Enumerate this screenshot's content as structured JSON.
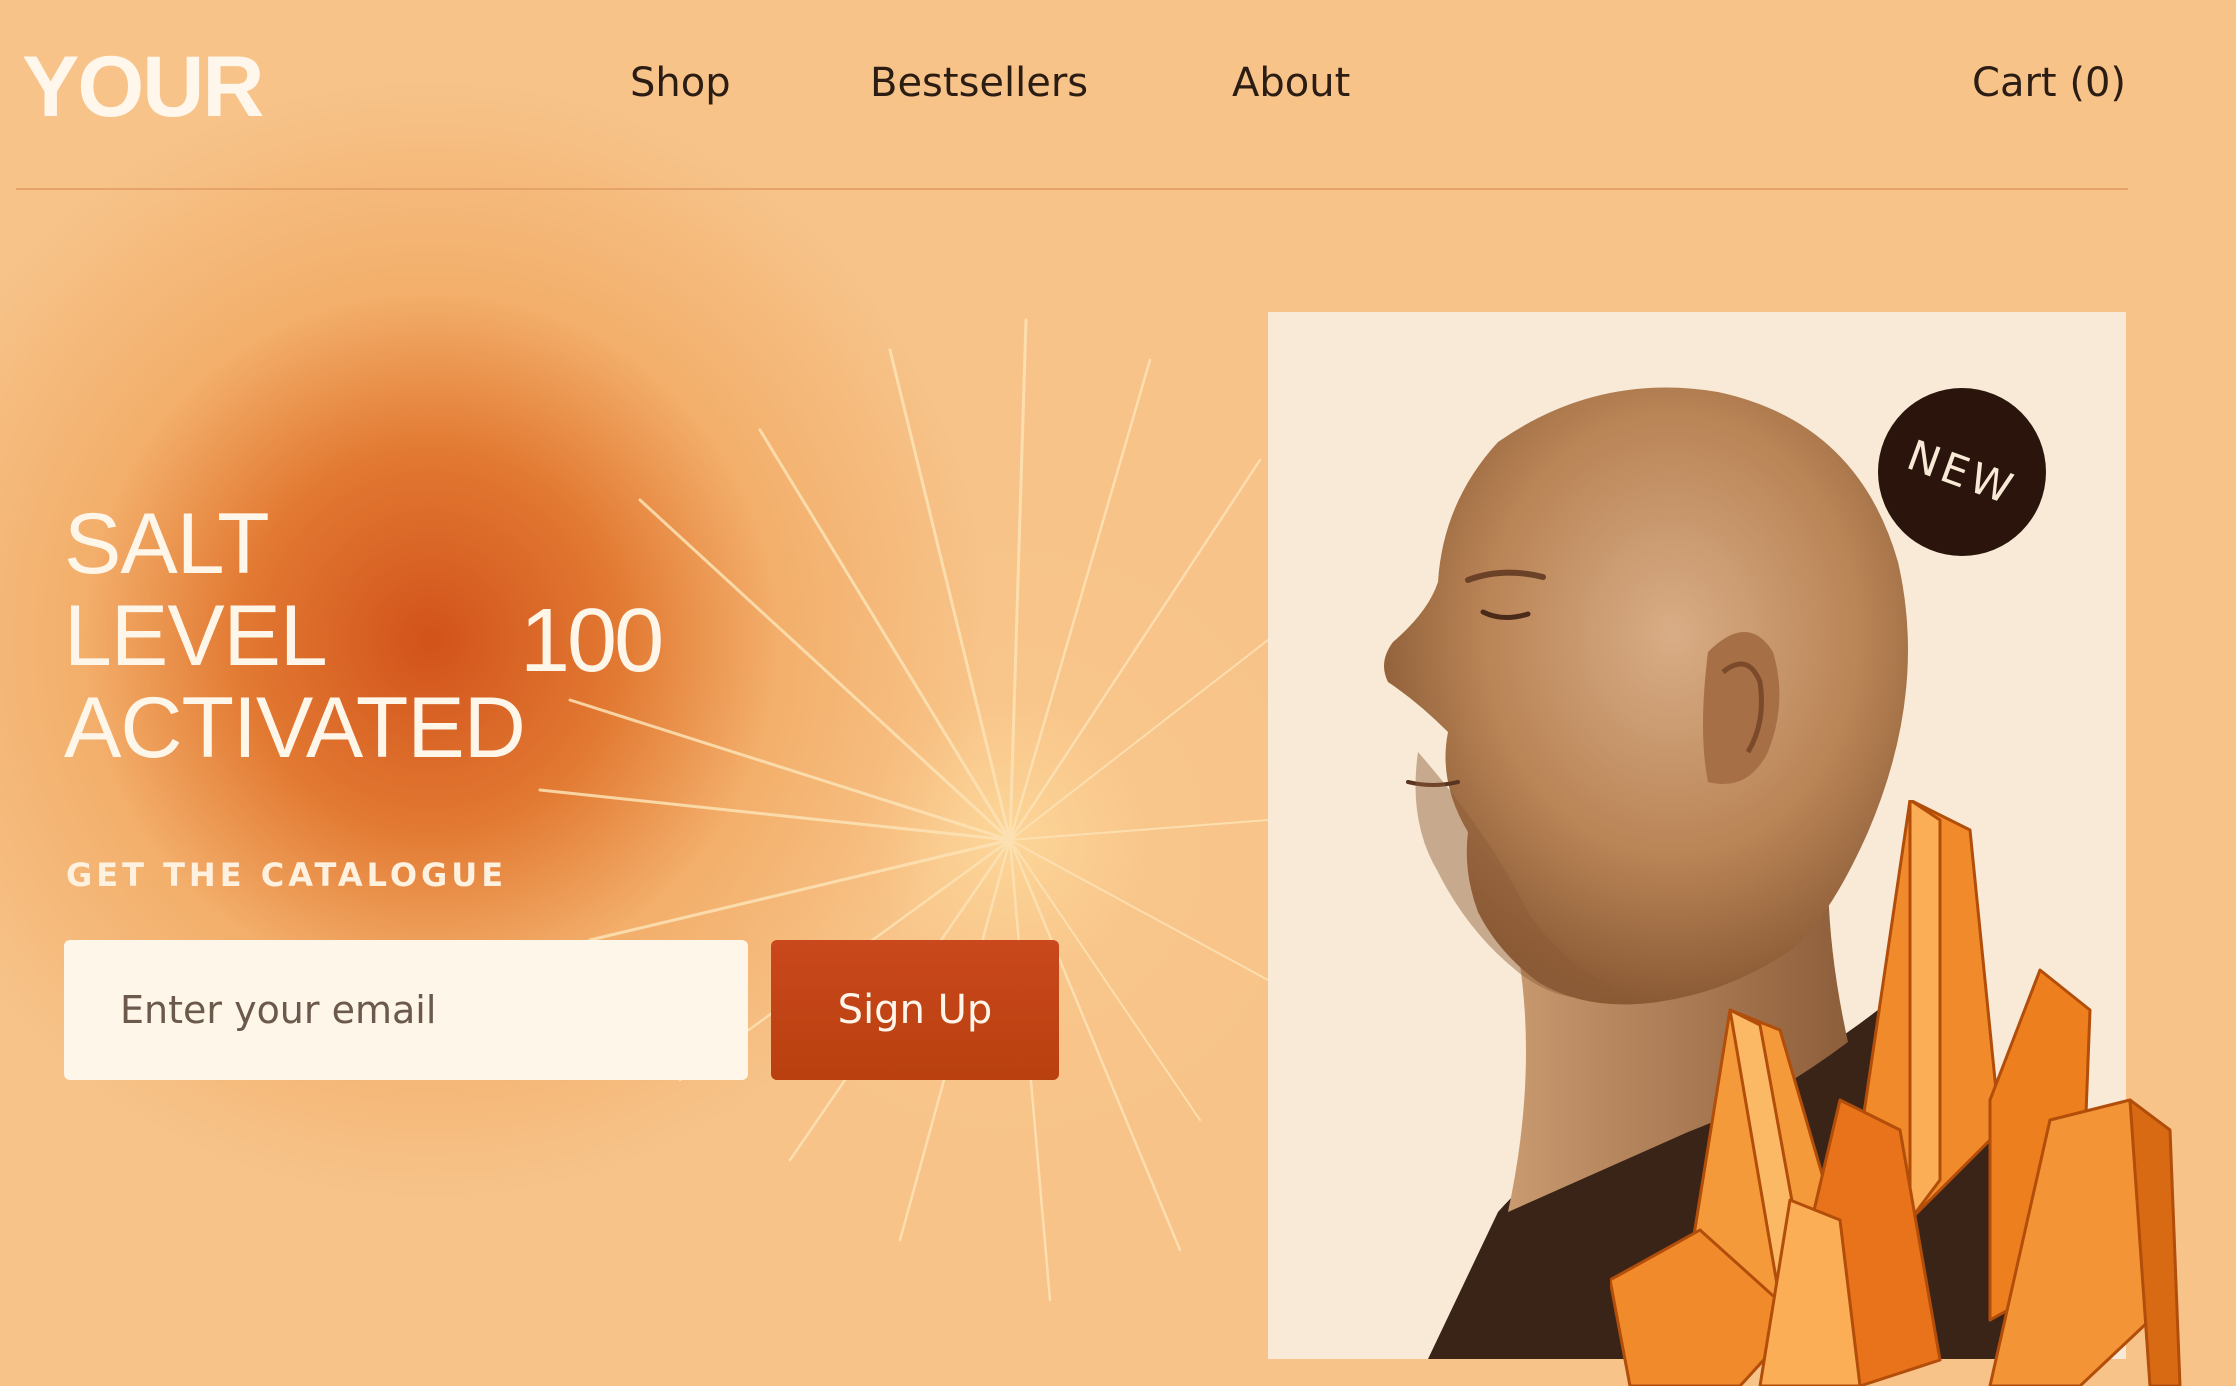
{
  "brand": {
    "logo_text": "YOUR"
  },
  "nav": {
    "items": [
      {
        "label": "Shop"
      },
      {
        "label": "Bestsellers"
      },
      {
        "label": "About"
      }
    ],
    "cart_label": "Cart (0)"
  },
  "hero": {
    "headline_lines": [
      "SALT",
      "LEVEL",
      "ACTIVATED"
    ],
    "headline_number": "100",
    "catalogue_label": "GET THE CATALOGUE",
    "email_placeholder": "Enter your email",
    "email_value": "",
    "signup_label": "Sign Up",
    "badge_text": "NEW"
  },
  "colors": {
    "background": "#f7c389",
    "glow_accent": "#d04e16",
    "button": "#c9481c",
    "input_background": "#fef6e8",
    "badge": "#2a140c",
    "card_background": "#f8ead6",
    "crystal": "#f08a2b"
  },
  "icons": {
    "sunburst": "sunburst-icon",
    "crystals": "orange-crystal-cluster"
  }
}
